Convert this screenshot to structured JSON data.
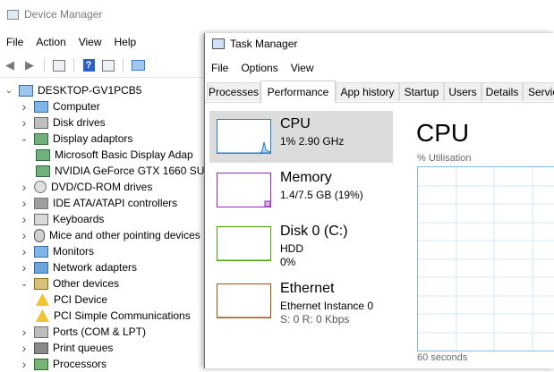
{
  "device_manager": {
    "title": "Device Manager",
    "menu": [
      "File",
      "Action",
      "View",
      "Help"
    ],
    "tree": {
      "root": "DESKTOP-GV1PCB5",
      "items": [
        {
          "label": "Computer",
          "icon": "computer-icon",
          "expand": "collapsed"
        },
        {
          "label": "Disk drives",
          "icon": "disk-drive-icon",
          "expand": "collapsed"
        },
        {
          "label": "Display adaptors",
          "icon": "display-adapter-icon",
          "expand": "expanded"
        },
        {
          "label": "Microsoft Basic Display Adap",
          "icon": "display-adapter-icon",
          "expand": "child"
        },
        {
          "label": "NVIDIA GeForce GTX 1660 SU",
          "icon": "display-adapter-icon",
          "expand": "child"
        },
        {
          "label": "DVD/CD-ROM drives",
          "icon": "dvd-icon",
          "expand": "collapsed"
        },
        {
          "label": "IDE ATA/ATAPI controllers",
          "icon": "ide-controller-icon",
          "expand": "collapsed"
        },
        {
          "label": "Keyboards",
          "icon": "keyboard-icon",
          "expand": "collapsed"
        },
        {
          "label": "Mice and other pointing devices",
          "icon": "mouse-icon",
          "expand": "collapsed"
        },
        {
          "label": "Monitors",
          "icon": "monitor-icon",
          "expand": "collapsed"
        },
        {
          "label": "Network adapters",
          "icon": "network-adapter-icon",
          "expand": "collapsed"
        },
        {
          "label": "Other devices",
          "icon": "other-devices-icon",
          "expand": "expanded"
        },
        {
          "label": "PCI Device",
          "icon": "warning-icon",
          "expand": "child"
        },
        {
          "label": "PCI Simple Communications",
          "icon": "warning-icon",
          "expand": "child"
        },
        {
          "label": "Ports (COM & LPT)",
          "icon": "port-icon",
          "expand": "collapsed"
        },
        {
          "label": "Print queues",
          "icon": "printer-icon",
          "expand": "collapsed"
        },
        {
          "label": "Processors",
          "icon": "processor-icon",
          "expand": "collapsed"
        }
      ]
    }
  },
  "task_manager": {
    "title": "Task Manager",
    "menu": [
      "File",
      "Options",
      "View"
    ],
    "tabs": [
      "Processes",
      "Performance",
      "App history",
      "Startup",
      "Users",
      "Details",
      "Servic"
    ],
    "active_tab": "Performance",
    "resources": [
      {
        "name": "CPU",
        "line1": "1% 2.90 GHz",
        "line2": "",
        "color": "#1f7fd1",
        "selected": true,
        "usage": 0.01
      },
      {
        "name": "Memory",
        "line1": "1.4/7.5 GB (19%)",
        "line2": "",
        "color": "#9528b4",
        "selected": false,
        "usage": 0.19
      },
      {
        "name": "Disk 0 (C:)",
        "line1": "HDD",
        "line2": "0%",
        "color": "#4da60c",
        "selected": false,
        "usage": 0.0
      },
      {
        "name": "Ethernet",
        "line1": "Ethernet Instance 0",
        "line2": "S: 0 R: 0 Kbps",
        "color": "#a74f01",
        "selected": false,
        "usage": 0.0
      }
    ],
    "detail": {
      "title": "CPU",
      "graph_label": "% Utilisation",
      "time_label": "60 seconds"
    }
  },
  "colors": {
    "cpu_graph_border": "#82bbe5",
    "cpu_graph_grid": "#d9eaf7",
    "selected_card": "#dcdcdc"
  }
}
